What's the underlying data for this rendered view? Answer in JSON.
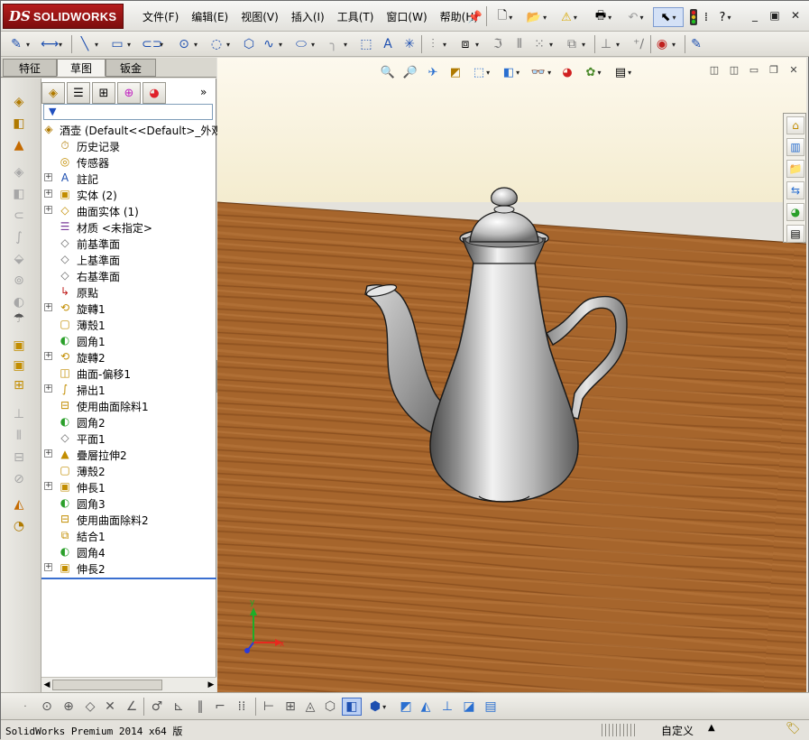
{
  "app": {
    "logo_ds": "DS",
    "logo_name": "SOLIDWORKS"
  },
  "menu": [
    {
      "label": "文件(F)"
    },
    {
      "label": "编辑(E)"
    },
    {
      "label": "视图(V)"
    },
    {
      "label": "插入(I)"
    },
    {
      "label": "工具(T)"
    },
    {
      "label": "窗口(W)"
    },
    {
      "label": "帮助(H)"
    }
  ],
  "tabs": [
    {
      "label": "特征"
    },
    {
      "label": "草图"
    },
    {
      "label": "钣金"
    }
  ],
  "active_tab": "草图",
  "tree": {
    "root_label": "酒壶  (Default<<Default>_外观",
    "items": [
      {
        "label": "历史记录",
        "icon": "history-icon",
        "glyph": "⏱",
        "expandable": false
      },
      {
        "label": "传感器",
        "icon": "sensor-icon",
        "glyph": "◎",
        "expandable": false
      },
      {
        "label": "註記",
        "icon": "annotation-icon",
        "glyph": "A",
        "expandable": true
      },
      {
        "label": "实体 (2)",
        "icon": "solid-bodies-icon",
        "glyph": "▣",
        "expandable": true
      },
      {
        "label": "曲面实体 (1)",
        "icon": "surface-bodies-icon",
        "glyph": "◇",
        "expandable": true
      },
      {
        "label": "材质 <未指定>",
        "icon": "material-icon",
        "glyph": "☰",
        "expandable": false
      },
      {
        "label": "前基準面",
        "icon": "plane-icon",
        "glyph": "◇",
        "expandable": false
      },
      {
        "label": "上基準面",
        "icon": "plane-icon",
        "glyph": "◇",
        "expandable": false
      },
      {
        "label": "右基準面",
        "icon": "plane-icon",
        "glyph": "◇",
        "expandable": false
      },
      {
        "label": "原點",
        "icon": "origin-icon",
        "glyph": "↳",
        "expandable": false
      },
      {
        "label": "旋轉1",
        "icon": "revolve-icon",
        "glyph": "⟲",
        "expandable": true
      },
      {
        "label": "薄殼1",
        "icon": "shell-icon",
        "glyph": "▢",
        "expandable": false
      },
      {
        "label": "圆角1",
        "icon": "fillet-icon",
        "glyph": "◐",
        "expandable": false
      },
      {
        "label": "旋轉2",
        "icon": "revolve-icon",
        "glyph": "⟲",
        "expandable": true
      },
      {
        "label": "曲面-偏移1",
        "icon": "offset-surface-icon",
        "glyph": "◫",
        "expandable": false
      },
      {
        "label": "掃出1",
        "icon": "sweep-icon",
        "glyph": "∫",
        "expandable": true
      },
      {
        "label": "使用曲面除料1",
        "icon": "surface-cut-icon",
        "glyph": "⊟",
        "expandable": false
      },
      {
        "label": "圆角2",
        "icon": "fillet-icon",
        "glyph": "◐",
        "expandable": false
      },
      {
        "label": "平面1",
        "icon": "plane-icon",
        "glyph": "◇",
        "expandable": false
      },
      {
        "label": "疊層拉伸2",
        "icon": "loft-icon",
        "glyph": "▲",
        "expandable": true
      },
      {
        "label": "薄殼2",
        "icon": "shell-icon",
        "glyph": "▢",
        "expandable": false
      },
      {
        "label": "伸長1",
        "icon": "extrude-icon",
        "glyph": "▣",
        "expandable": true
      },
      {
        "label": "圆角3",
        "icon": "fillet-icon",
        "glyph": "◐",
        "expandable": false
      },
      {
        "label": "使用曲面除料2",
        "icon": "surface-cut-icon",
        "glyph": "⊟",
        "expandable": false
      },
      {
        "label": "結合1",
        "icon": "combine-icon",
        "glyph": "⧉",
        "expandable": false
      },
      {
        "label": "圆角4",
        "icon": "fillet-icon",
        "glyph": "◐",
        "expandable": false
      },
      {
        "label": "伸長2",
        "icon": "extrude-icon",
        "glyph": "▣",
        "expandable": true
      }
    ]
  },
  "viewport": {
    "model_name": "teapot",
    "triad_x": "x",
    "triad_y": "y",
    "triad_x_color": "#e8281e",
    "triad_y_color": "#1cae28",
    "triad_z_color": "#2a3bd8"
  },
  "status": {
    "text": "SolidWorks Premium 2014 x64 版",
    "custom_label": "自定义",
    "arrow": "▲"
  },
  "colors": {
    "brand_red": "#a31515",
    "selection_blue": "#3a6fd0",
    "wall": "#fbf4df",
    "wood": "#a2622a"
  }
}
